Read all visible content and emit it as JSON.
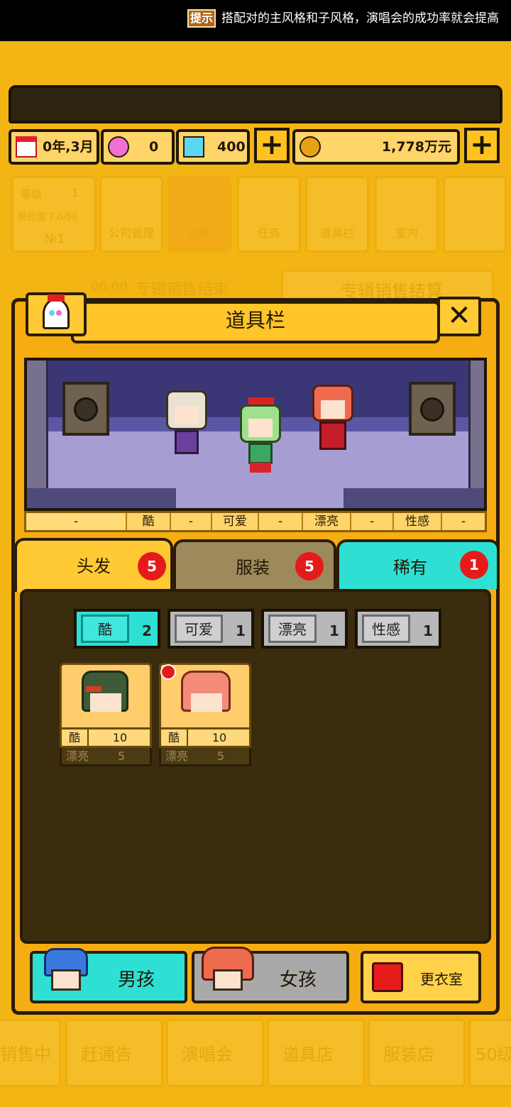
{
  "hint": {
    "badge": "提示",
    "text": "搭配对的主风格和子风格，演唱会的成功率就会提高"
  },
  "resources": {
    "date": "0年,3月",
    "gems_pink": "0",
    "gems_blue": "400",
    "money": "1,778万元"
  },
  "background_menu": {
    "level_label": "等级",
    "level_value": "1",
    "exp_label": "经验值 7.0/50",
    "rank": "№1",
    "tiles": [
      "公司管理",
      "招募",
      "任务",
      "道具栏",
      "室内"
    ],
    "sale_time": "00:00",
    "sale_status": "专辑销售结束",
    "sale_button": "专辑销售结算"
  },
  "bottom_nav": [
    "销售中",
    "赶通告",
    "演唱会",
    "道具店",
    "服装店",
    "50级"
  ],
  "panel": {
    "title": "道具栏",
    "close_label": "✕"
  },
  "style_bar": [
    "-",
    "酷",
    "-",
    "可爱",
    "-",
    "漂亮",
    "-",
    "性感",
    "-"
  ],
  "category_tabs": [
    {
      "label": "头发",
      "badge": "5"
    },
    {
      "label": "服装",
      "badge": "5"
    },
    {
      "label": "稀有",
      "badge": "1"
    }
  ],
  "filters": [
    {
      "label": "酷",
      "count": "2"
    },
    {
      "label": "可爱",
      "count": "1"
    },
    {
      "label": "漂亮",
      "count": "1"
    },
    {
      "label": "性感",
      "count": "1"
    }
  ],
  "items": [
    {
      "stat1_label": "酷",
      "stat1_value": "10",
      "stat2_label": "漂亮",
      "stat2_value": "5"
    },
    {
      "stat1_label": "酷",
      "stat1_value": "10",
      "stat2_label": "漂亮",
      "stat2_value": "5"
    }
  ],
  "bottom_buttons": {
    "boy": "男孩",
    "girl": "女孩",
    "wardrobe": "更衣室"
  },
  "colors": {
    "background": "#f3b513",
    "active_teal": "#2ee0d4",
    "badge_red": "#e51b1b",
    "content_dark": "#3a2c0d"
  }
}
